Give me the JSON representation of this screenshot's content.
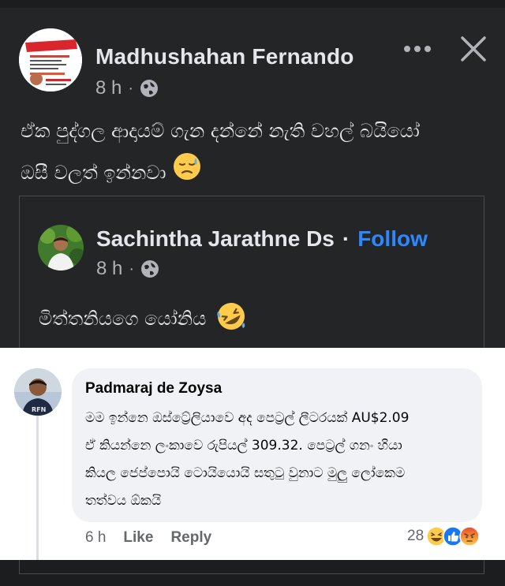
{
  "post": {
    "author": "Madhushahan Fernando",
    "time": "8 h",
    "separator": "·",
    "audience_icon": "globe-icon",
    "line1": "ඒක පුද්ගල ආදායම් ගැන දන්නේ නැති වහල් බයියෝ",
    "line2": "ඔසී වලත් ඉන්නවා",
    "emoji": "downcast-sweat-face"
  },
  "shared_post": {
    "author": "Sachintha Jarathne Ds",
    "separator": "·",
    "follow_label": "Follow",
    "time": "8 h",
    "audience_icon": "globe-icon",
    "text": "මිත්තනියගෙ යෝනිය",
    "emoji": "rolling-laughing-face"
  },
  "comment": {
    "author": "Padmaraj de Zoysa",
    "text": "මම ඉන්නෙ ඔස්ට්‍රේලියාවෙ අද පෙට්‍රල් ලීටරයක් AU$2.09\nඒ කියන්නෙ ලංකාවෙ රුපියල් 309.32.  පෙට්‍රල් ගනං හියා\nකියල ජෙප්පොයි ටොයියොයි සතුටු වුනාට මුලු ලෝකෙම\nතත්වය ඕකයි",
    "time": "6 h",
    "like_label": "Like",
    "reply_label": "Reply",
    "reaction_count": "28",
    "reactions": [
      "haha",
      "like",
      "angry"
    ]
  },
  "colors": {
    "dark_bg": "#242526",
    "follow_blue": "#2d88ff",
    "bubble_bg": "#f0f2f5"
  }
}
